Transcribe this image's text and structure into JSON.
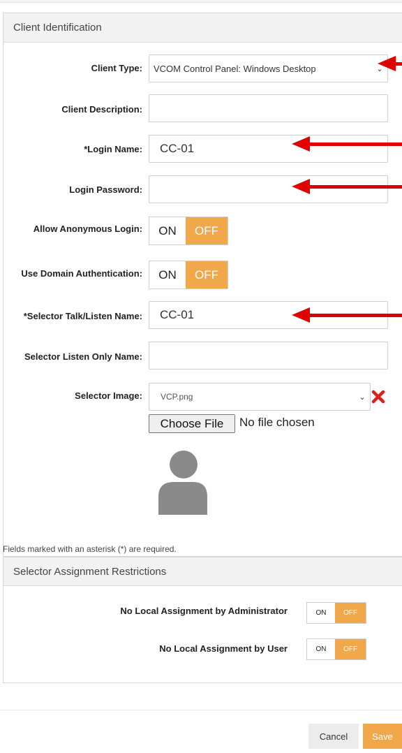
{
  "client_identification": {
    "title": "Client Identification",
    "client_type_label": "Client Type:",
    "client_type_value": "VCOM Control Panel: Windows Desktop",
    "client_description_label": "Client Description:",
    "client_description_value": "",
    "login_name_label": "*Login Name:",
    "login_name_value": "CC-01",
    "login_password_label": "Login Password:",
    "login_password_value": "",
    "allow_anonymous_label": "Allow Anonymous Login:",
    "use_domain_auth_label": "Use Domain Authentication:",
    "toggle_on": "ON",
    "toggle_off": "OFF",
    "talk_listen_label": "*Selector Talk/Listen Name:",
    "talk_listen_value": "CC-01",
    "listen_only_label": "Selector Listen Only Name:",
    "listen_only_value": "",
    "selector_image_label": "Selector Image:",
    "selector_image_value": "VCP.png",
    "choose_file_label": "Choose File",
    "no_file_text": "No file chosen",
    "required_note": "Fields marked with an asterisk (*) are required."
  },
  "restrictions": {
    "title": "Selector Assignment Restrictions",
    "admin_label": "No Local Assignment by Administrator",
    "user_label": "No Local Assignment by User",
    "toggle_on": "ON",
    "toggle_off": "OFF"
  },
  "footer": {
    "cancel_label": "Cancel",
    "save_label": "Save"
  },
  "colors": {
    "accent_orange": "#f1a84a",
    "annotation_red": "#e00000",
    "remove_x": "#d9201a"
  },
  "icons": [
    "chevron-down-icon",
    "remove-x-icon",
    "avatar-placeholder-icon",
    "red-arrow-annotation"
  ]
}
